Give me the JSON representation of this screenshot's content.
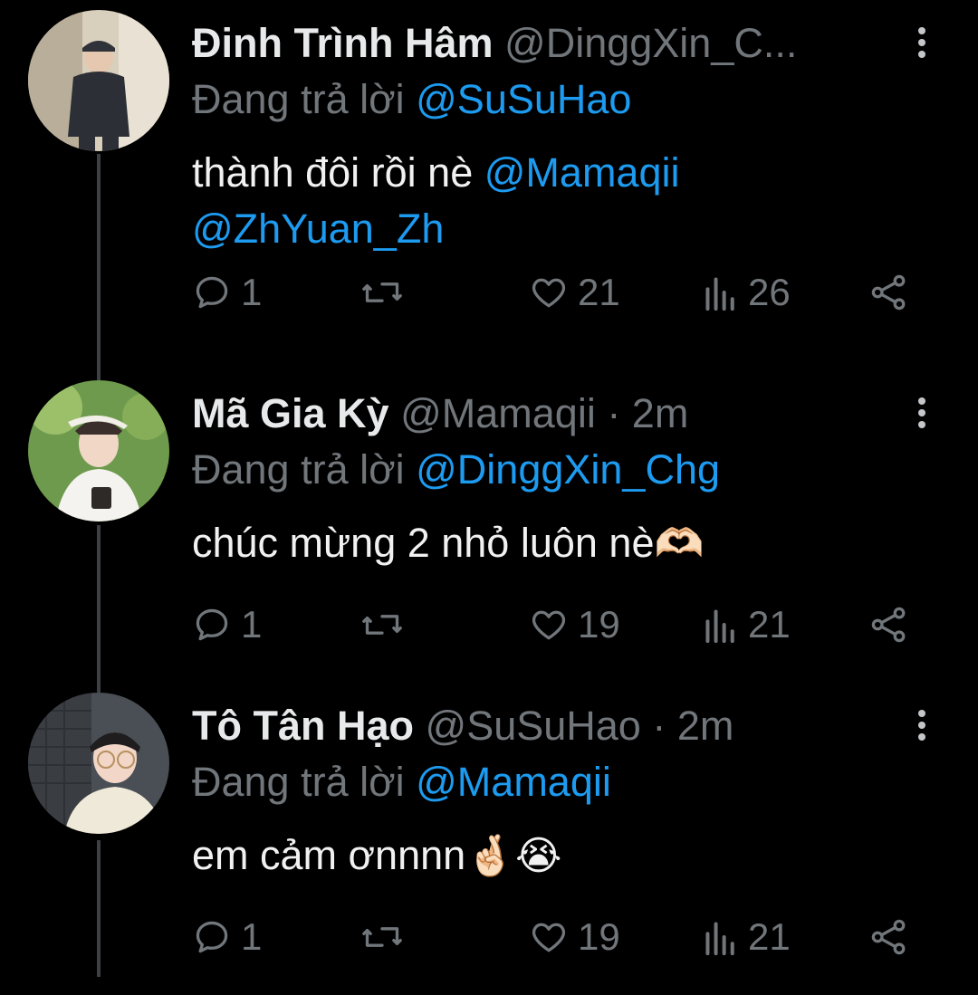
{
  "tweets": [
    {
      "name": "Đinh Trình Hâm",
      "handle_time": "@DinggXin_C...",
      "reply_prefix": "Đang trả lời",
      "reply_to": "@SuSuHao",
      "text_plain": "thành đôi rồi nè",
      "mention_1": "@Mamaqii",
      "mention_2": "@ZhYuan_Zh",
      "replies": "1",
      "likes": "21",
      "views": "26"
    },
    {
      "name": "Mã Gia Kỳ",
      "handle_time": "@Mamaqii · 2m",
      "reply_prefix": "Đang trả lời",
      "reply_to": "@DinggXin_Chg",
      "text": "chúc mừng 2 nhỏ luôn nè",
      "emoji": "🫶🏻",
      "replies": "1",
      "likes": "19",
      "views": "21"
    },
    {
      "name": "Tô Tân Hạo",
      "handle_time": "@SuSuHao · 2m",
      "reply_prefix": "Đang trả lời",
      "reply_to": "@Mamaqii",
      "text": "em cảm ơnnnn",
      "emoji": "🤞🏻😭",
      "replies": "1",
      "likes": "19",
      "views": "21"
    }
  ],
  "colors": {
    "background": "#000000",
    "link": "#1d9bf0",
    "muted": "#71767b",
    "thread_line": "#3b4147"
  },
  "icons": [
    "reply-icon",
    "retweet-icon",
    "like-icon",
    "views-icon",
    "share-icon",
    "more-icon"
  ]
}
